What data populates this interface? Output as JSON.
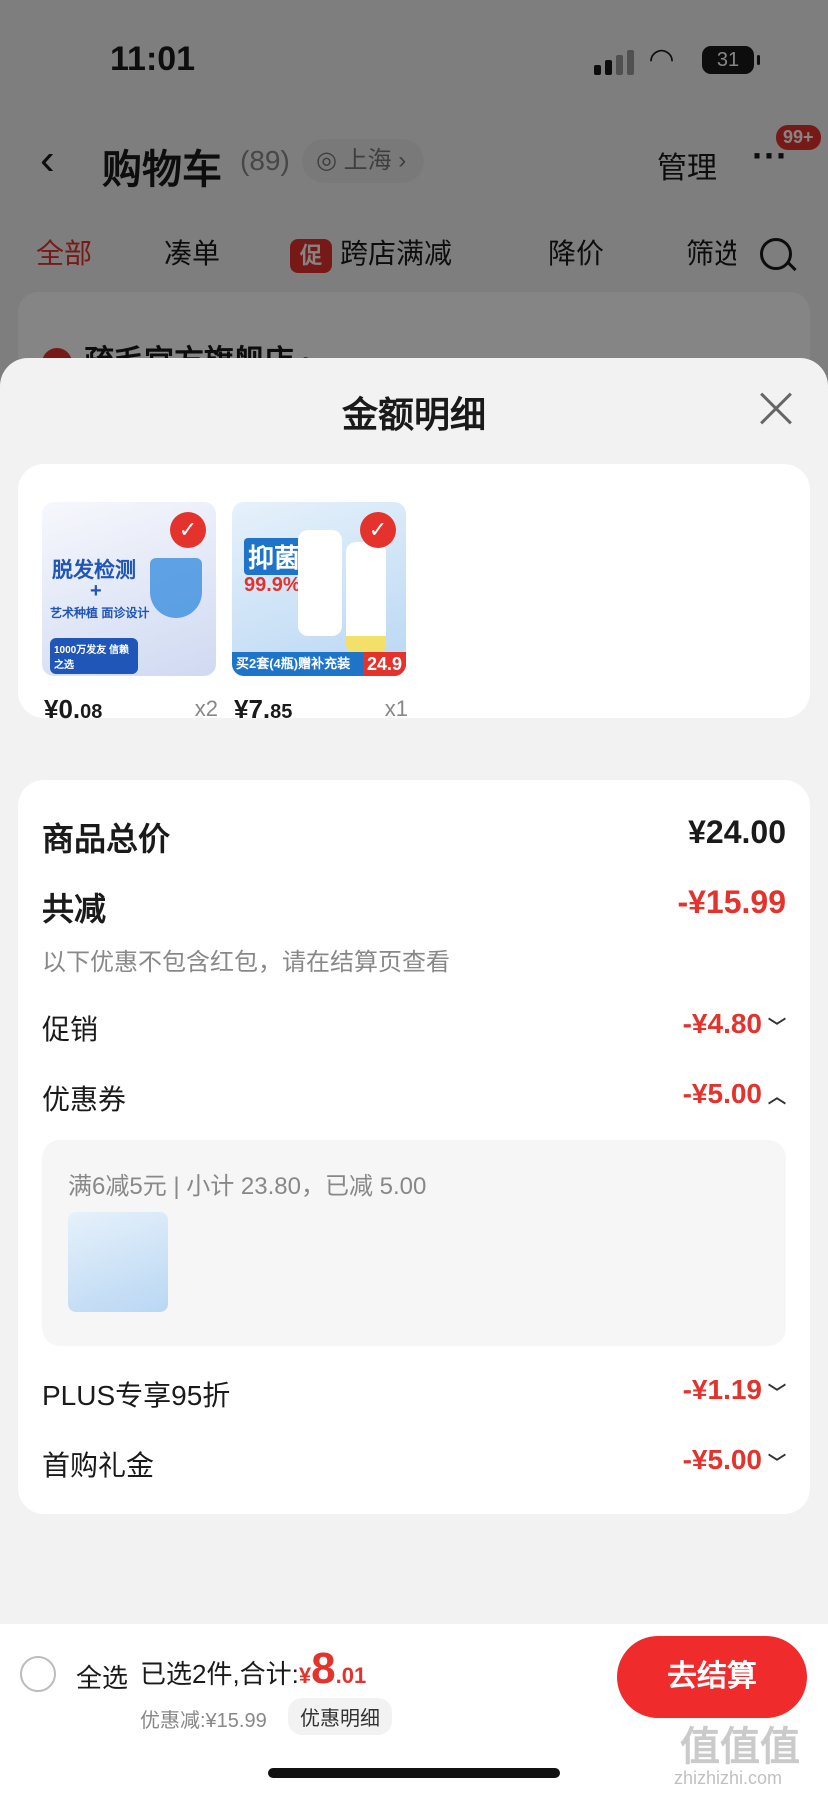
{
  "status_bar": {
    "time": "11:01",
    "battery": "31"
  },
  "header": {
    "title": "购物车",
    "count": "(89)",
    "location": "上海",
    "manage_label": "管理",
    "more_badge": "99+"
  },
  "tabs": [
    {
      "label": "全部"
    },
    {
      "label": "凑单"
    },
    {
      "label": "跨店满减",
      "tag": "促"
    },
    {
      "label": "降价"
    },
    {
      "label": "筛选"
    }
  ],
  "shop": {
    "name": "疏毛宫方旗舰店 ›"
  },
  "sheet": {
    "title": "金额明细",
    "products": [
      {
        "price_int": "¥0.",
        "price_dec": "08",
        "qty": "x2",
        "img_text": "脱发检测",
        "img_sub": "+",
        "img_line": "艺术种植 面诊设计",
        "img_tag": "1000万发友 信赖之选"
      },
      {
        "price_int": "¥7.",
        "price_dec": "85",
        "qty": "x1",
        "img_text": "抑菌",
        "img_sub": "99.9%",
        "img_line": "买2套(4瓶)赠补充装",
        "img_tag": "24.9"
      }
    ],
    "total": {
      "label": "商品总价",
      "value": "¥24.00"
    },
    "reduce": {
      "label": "共减",
      "value": "-¥15.99",
      "note": "以下优惠不包含红包，请在结算页查看"
    },
    "promo": {
      "label": "促销",
      "value": "-¥4.80"
    },
    "coupon": {
      "label": "优惠券",
      "value": "-¥5.00",
      "detail": "满6减5元 | 小计 23.80，已减 5.00"
    },
    "plus": {
      "label": "PLUS专享95折",
      "value": "-¥1.19"
    },
    "first": {
      "label": "首购礼金",
      "value": "-¥5.00"
    }
  },
  "bottom": {
    "select_all": "全选",
    "summary_prefix": "已选2件,合计:",
    "total_symbol": "¥",
    "total_int": "8",
    "total_dec": ".01",
    "discount": "优惠减:¥15.99",
    "detail_button": "优惠明细",
    "checkout": "去结算"
  },
  "watermark": {
    "text": "值值值",
    "site": "zhizhizhi.com"
  }
}
